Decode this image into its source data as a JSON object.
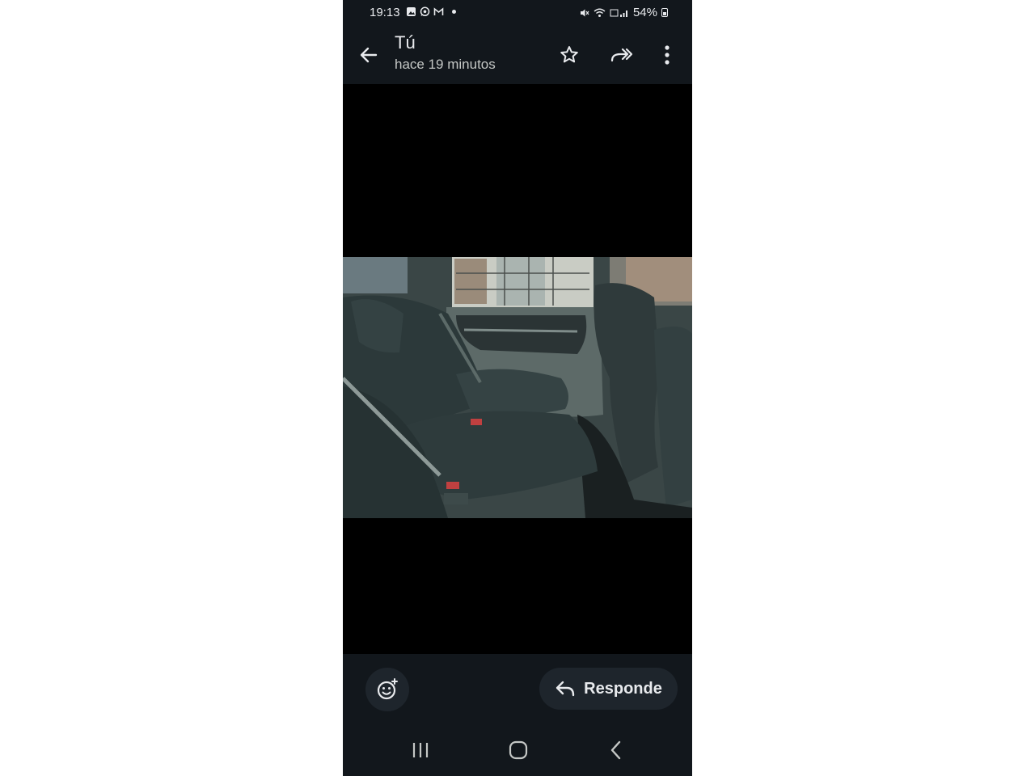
{
  "status_bar": {
    "time": "19:13",
    "battery": "54%",
    "notification_icons": [
      "gallery-icon",
      "whatsapp-icon",
      "gmail-icon"
    ],
    "system_icons": [
      "mute-icon",
      "wifi-icon",
      "volte-signal-icon",
      "battery-icon"
    ]
  },
  "header": {
    "sender": "Tú",
    "time_ago": "hace 19 minutos",
    "actions": [
      "back-arrow-icon",
      "star-icon",
      "forward-all-icon",
      "more-vert-icon"
    ]
  },
  "content": {
    "image_subject": "car-rear-seat-photo"
  },
  "footer": {
    "emoji_icon": "add-reaction-icon",
    "reply_label": "Responde",
    "reply_icon": "reply-icon"
  },
  "nav": {
    "buttons": [
      "recent-apps-icon",
      "home-icon",
      "back-nav-icon"
    ]
  },
  "colors": {
    "background": "#12171c",
    "button_surface": "#1e252c",
    "text": "#e8eaed",
    "subtext": "#c4c7c5",
    "viewer": "#000000"
  }
}
